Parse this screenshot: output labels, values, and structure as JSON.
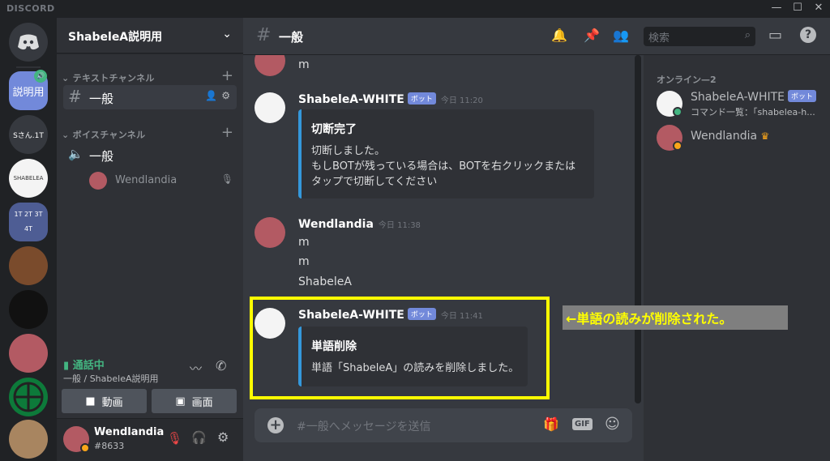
{
  "app": {
    "brand": "DISCORD"
  },
  "window_controls": {
    "minimize": "—",
    "maximize": "☐",
    "close": "✕"
  },
  "guilds": [
    {
      "label": "説明用",
      "badge": "🔊"
    },
    {
      "label": "Sさん.1T"
    },
    {
      "label": "SHABELEA"
    },
    {
      "label": "1T 2T 3T 4T"
    }
  ],
  "server": {
    "name": "ShabeleA説明用"
  },
  "categories": {
    "text": "テキストチャンネル",
    "voice": "ボイスチャンネル"
  },
  "channels": {
    "text_selected": "一般",
    "voice": "一般",
    "voice_member": "Wendlandia"
  },
  "voice_status": {
    "title": "通話中",
    "subtitle": "一般 / ShabeleA説明用"
  },
  "voice_buttons": {
    "video": "動画",
    "screen": "画面"
  },
  "user": {
    "name": "Wendlandia",
    "tag": "#8633"
  },
  "header": {
    "channel": "一般",
    "search_placeholder": "検索"
  },
  "messages": {
    "top_partial": {
      "text": "m"
    },
    "m1": {
      "author": "ShabeleA-WHITE",
      "bot_tag": "ボット",
      "time": "今日 11:20",
      "embed_title": "切断完了",
      "embed_lines": [
        "切断しました。",
        "もしBOTが残っている場合は、BOTを右クリックまたは",
        "タップで切断してください"
      ]
    },
    "m2": {
      "author": "Wendlandia",
      "time": "今日 11:38",
      "lines": [
        "m",
        "m",
        "ShabeleA"
      ]
    },
    "m3": {
      "author": "ShabeleA-WHITE",
      "bot_tag": "ボット",
      "time": "今日 11:41",
      "embed_title": "単語削除",
      "embed_lines": [
        "単語「ShabeleA」の読みを削除しました。"
      ]
    }
  },
  "input": {
    "placeholder": "#一般へメッセージを送信",
    "gif": "GIF"
  },
  "members": {
    "header": "オンライン—2",
    "list": [
      {
        "name": "ShabeleA-WHITE",
        "bot_tag": "ボット",
        "activity": "コマンド一覧：「shabelea-h..."
      },
      {
        "name": "Wendlandia",
        "crown": "♛"
      }
    ]
  },
  "annotation": {
    "text": "←単語の読みが削除された。"
  },
  "colors": {
    "accent": "#7289da",
    "embed_bar": "#3498db",
    "highlight": "#ffff00",
    "online": "#43b581",
    "voice_green": "#43b581"
  }
}
